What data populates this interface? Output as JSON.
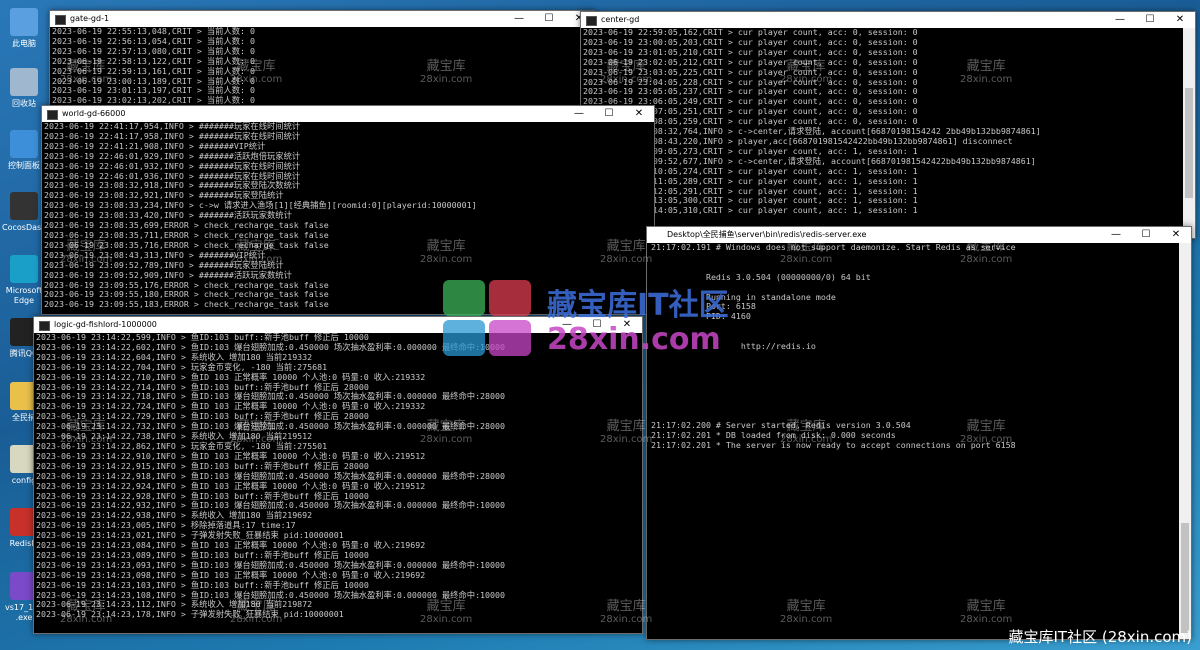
{
  "desktop_icons": [
    {
      "label": "此电脑",
      "icon": "computer-icon",
      "color": "#5aa0e0"
    },
    {
      "label": "回收站",
      "icon": "recycle-bin-icon",
      "color": "#9fb8d0"
    },
    {
      "label": "控制面板",
      "icon": "control-panel-icon",
      "color": "#3c8fd8"
    },
    {
      "label": "CocosDas...",
      "icon": "cocos-icon",
      "color": "#333333"
    },
    {
      "label": "Microsoft Edge",
      "icon": "edge-icon",
      "color": "#1aa0c8"
    },
    {
      "label": "腾讯QQ",
      "icon": "qq-icon",
      "color": "#222222"
    },
    {
      "label": "全民捕",
      "icon": "folder-icon",
      "color": "#e8c04a"
    },
    {
      "label": "config",
      "icon": "config-file-icon",
      "color": "#d8d8c0"
    },
    {
      "label": "RedisPl",
      "icon": "redis-icon",
      "color": "#c8302a"
    },
    {
      "label": "vs17_15x .exe",
      "icon": "visual-studio-icon",
      "color": "#7a4ac8"
    }
  ],
  "windows": {
    "gate": {
      "title": "gate-gd-1",
      "lines": [
        "2023-06-19 22:55:13,048,CRIT > 当前人数: 0",
        "2023-06-19 22:56:13,054,CRIT > 当前人数: 0",
        "2023-06-19 22:57:13,080,CRIT > 当前人数: 0",
        "2023-06-19 22:58:13,122,CRIT > 当前人数: 0",
        "2023-06-19 22:59:13,161,CRIT > 当前人数: 0",
        "2023-06-19 23:00:13,189,CRIT > 当前人数: 0",
        "2023-06-19 23:01:13,197,CRIT > 当前人数: 0",
        "2023-06-19 23:02:13,202,CRIT > 当前人数: 0"
      ]
    },
    "center": {
      "title": "center-gd",
      "lines": [
        "2023-06-19 22:59:05,162,CRIT > cur player count, acc: 0, session: 0",
        "2023-06-19 23:00:05,203,CRIT > cur player count, acc: 0, session: 0",
        "2023-06-19 23:01:05,210,CRIT > cur player count, acc: 0, session: 0",
        "2023-06-19 23:02:05,212,CRIT > cur player count, acc: 0, session: 0",
        "2023-06-19 23:03:05,225,CRIT > cur player count, acc: 0, session: 0",
        "2023-06-19 23:04:05,228,CRIT > cur player count, acc: 0, session: 0",
        "2023-06-19 23:05:05,237,CRIT > cur player count, acc: 0, session: 0",
        "2023-06-19 23:06:05,249,CRIT > cur player count, acc: 0, session: 0",
        "2023-06-19 23:07:05,251,CRIT > cur player count, acc: 0, session: 0",
        "2023-06-19 23:08:05,259,CRIT > cur player count, acc: 0, session: 0",
        "2023-06-19 23:08:32,764,INFO > c->center,请求登陆, account[66870198154242 2bb49b132bb9874861]",
        "2023-06-19 23:08:43,220,INFO > player,acc[668701981542422bb49b132bb9874861] disconnect",
        "2023-06-19 23:09:05,273,CRIT > cur player count, acc: 1, session: 1",
        "2023-06-19 23:09:52,677,INFO > c->center,请求登陆, account[668701981542422bb49b132bb9874861]",
        "2023-06-19 23:10:05,274,CRIT > cur player count, acc: 1, session: 1",
        "2023-06-19 23:11:05,289,CRIT > cur player count, acc: 1, session: 1",
        "2023-06-19 23:12:05,291,CRIT > cur player count, acc: 1, session: 1",
        "2023-06-19 23:13:05,300,CRIT > cur player count, acc: 1, session: 1",
        "2023-06-19 23:14:05,310,CRIT > cur player count, acc: 1, session: 1"
      ]
    },
    "world": {
      "title": "world-gd-66000",
      "lines": [
        "2023-06-19 22:41:17,954,INFO > #######玩家在线时间统计",
        "2023-06-19 22:41:17,958,INFO > #######玩家在线时间统计",
        "2023-06-19 22:41:21,908,INFO > #######VIP统计",
        "2023-06-19 22:46:01,929,INFO > #######活跃炮倍玩家统计",
        "2023-06-19 22:46:01,932,INFO > #######玩家在线时间统计",
        "2023-06-19 22:46:01,936,INFO > #######玩家在线时间统计",
        "2023-06-19 23:08:32,918,INFO > #######玩家登陆次数统计",
        "2023-06-19 23:08:32,921,INFO > #######玩家登陆统计",
        "2023-06-19 23:08:33,234,INFO > c->w 请求进入渔场[1][经典捕鱼][roomid:0][playerid:10000001]",
        "2023-06-19 23:08:33,420,INFO > #######活跃玩家数统计",
        "2023-06-19 23:08:35,699,ERROR > check_recharge_task false",
        "2023-06-19 23:08:35,711,ERROR > check_recharge_task false",
        "2023-06-19 23:08:35,716,ERROR > check_recharge_task false",
        "2023-06-19 23:08:43,313,INFO > #######VIP统计",
        "2023-06-19 23:09:52,789,INFO > #######玩家登陆统计",
        "2023-06-19 23:09:52,909,INFO > #######活跃玩家数统计",
        "2023-06-19 23:09:55,176,ERROR > check_recharge_task false",
        "2023-06-19 23:09:55,180,ERROR > check_recharge_task false",
        "2023-06-19 23:09:55,183,ERROR > check_recharge_task false"
      ]
    },
    "logic": {
      "title": "logic-gd-fishlord-1000000",
      "lines": [
        "2023-06-19 23:14:22,599,INFO > 鱼ID:103 buff::新手池buff 修正后 10000",
        "2023-06-19 23:14:22,602,INFO > 鱼ID:103 爆台翅膀加成:0.450000 场次抽水盈利率:0.000000 最终命中:10000",
        "2023-06-19 23:14:22,604,INFO > 系统收入 增加180 当前219332",
        "2023-06-19 23:14:22,704,INFO > 玩家金币变化, -180 当前:275681",
        "2023-06-19 23:14:22,710,INFO > 鱼ID 103 正常概率 10000 个人池:0 码量:0 收入:219332",
        "2023-06-19 23:14:22,714,INFO > 鱼ID:103 buff::新手池buff 修正后 28000",
        "2023-06-19 23:14:22,718,INFO > 鱼ID:103 爆台翅膀加成:0.450000 场次抽水盈利率:0.000000 最终命中:28000",
        "2023-06-19 23:14:22,724,INFO > 鱼ID 103 正常概率 10000 个人池:0 码量:0 收入:219332",
        "2023-06-19 23:14:22,729,INFO > 鱼ID:103 buff::新手池buff 修正后 28000",
        "2023-06-19 23:14:22,732,INFO > 鱼ID:103 爆台翅膀加成:0.450000 场次抽水盈利率:0.000000 最终命中:28000",
        "2023-06-19 23:14:22,738,INFO > 系统收入 增加180 当前219512",
        "2023-06-19 23:14:22,862,INFO > 玩家金币变化, -180 当前:275501",
        "2023-06-19 23:14:22,910,INFO > 鱼ID 103 正常概率 10000 个人池:0 码量:0 收入:219512",
        "2023-06-19 23:14:22,915,INFO > 鱼ID:103 buff::新手池buff 修正后 28000",
        "2023-06-19 23:14:22,918,INFO > 鱼ID:103 爆台翅膀加成:0.450000 场次抽水盈利率:0.000000 最终命中:28000",
        "2023-06-19 23:14:22,924,INFO > 鱼ID 103 正常概率 10000 个人池:0 码量:0 收入:219512",
        "2023-06-19 23:14:22,928,INFO > 鱼ID:103 buff::新手池buff 修正后 10000",
        "2023-06-19 23:14:22,932,INFO > 鱼ID:103 爆台翅膀加成:0.450000 场次抽水盈利率:0.000000 最终命中:10000",
        "2023-06-19 23:14:22,938,INFO > 系统收入 增加180 当前219692",
        "2023-06-19 23:14:23,005,INFO > 移除掉落道具:17 time:17",
        "2023-06-19 23:14:23,021,INFO > 子弹发射失败_狂暴结束 pid:10000001",
        "2023-06-19 23:14:23,084,INFO > 鱼ID 103 正常概率 10000 个人池:0 码量:0 收入:219692",
        "2023-06-19 23:14:23,089,INFO > 鱼ID:103 buff::新手池buff 修正后 10000",
        "2023-06-19 23:14:23,093,INFO > 鱼ID:103 爆台翅膀加成:0.450000 场次抽水盈利率:0.000000 最终命中:10000",
        "2023-06-19 23:14:23,098,INFO > 鱼ID 103 正常概率 10000 个人池:0 码量:0 收入:219692",
        "2023-06-19 23:14:23,103,INFO > 鱼ID:103 buff::新手池buff 修正后 10000",
        "2023-06-19 23:14:23,108,INFO > 鱼ID:103 爆台翅膀加成:0.450000 场次抽水盈利率:0.000000 最终命中:10000",
        "2023-06-19 23:14:23,112,INFO > 系统收入 增加180 当前219872",
        "2023-06-19 23:14:23,178,INFO > 子弹发射失败_狂暴结束 pid:10000001"
      ]
    },
    "redis": {
      "title": "Desktop\\全民捕鱼\\server\\bin\\redis\\redis-server.exe",
      "lines": [
        "21:17:02.191 # Windows does not support daemonize. Start Redis as service",
        "",
        "",
        "           Redis 3.0.504 (00000000/0) 64 bit",
        "",
        "           Running in standalone mode",
        "           Port: 6158",
        "           PID: 4160",
        "",
        "",
        "                  http://redis.io",
        "",
        "",
        "",
        "",
        "",
        "",
        "",
        "21:17:02.200 # Server started, Redis version 3.0.504",
        "21:17:02.201 * DB loaded from disk: 0.000 seconds",
        "21:17:02.201 * The server is now ready to accept connections on port 6158"
      ]
    }
  },
  "window_controls": {
    "minimize": "—",
    "maximize": "☐",
    "close": "✕"
  },
  "watermark": {
    "cn": "藏宝库",
    "en": "28xin.com"
  },
  "logo": {
    "cn": "藏宝库IT社区",
    "en": "28xin.com"
  },
  "bottom_brand": "藏宝库IT社区 (28xin.com)"
}
